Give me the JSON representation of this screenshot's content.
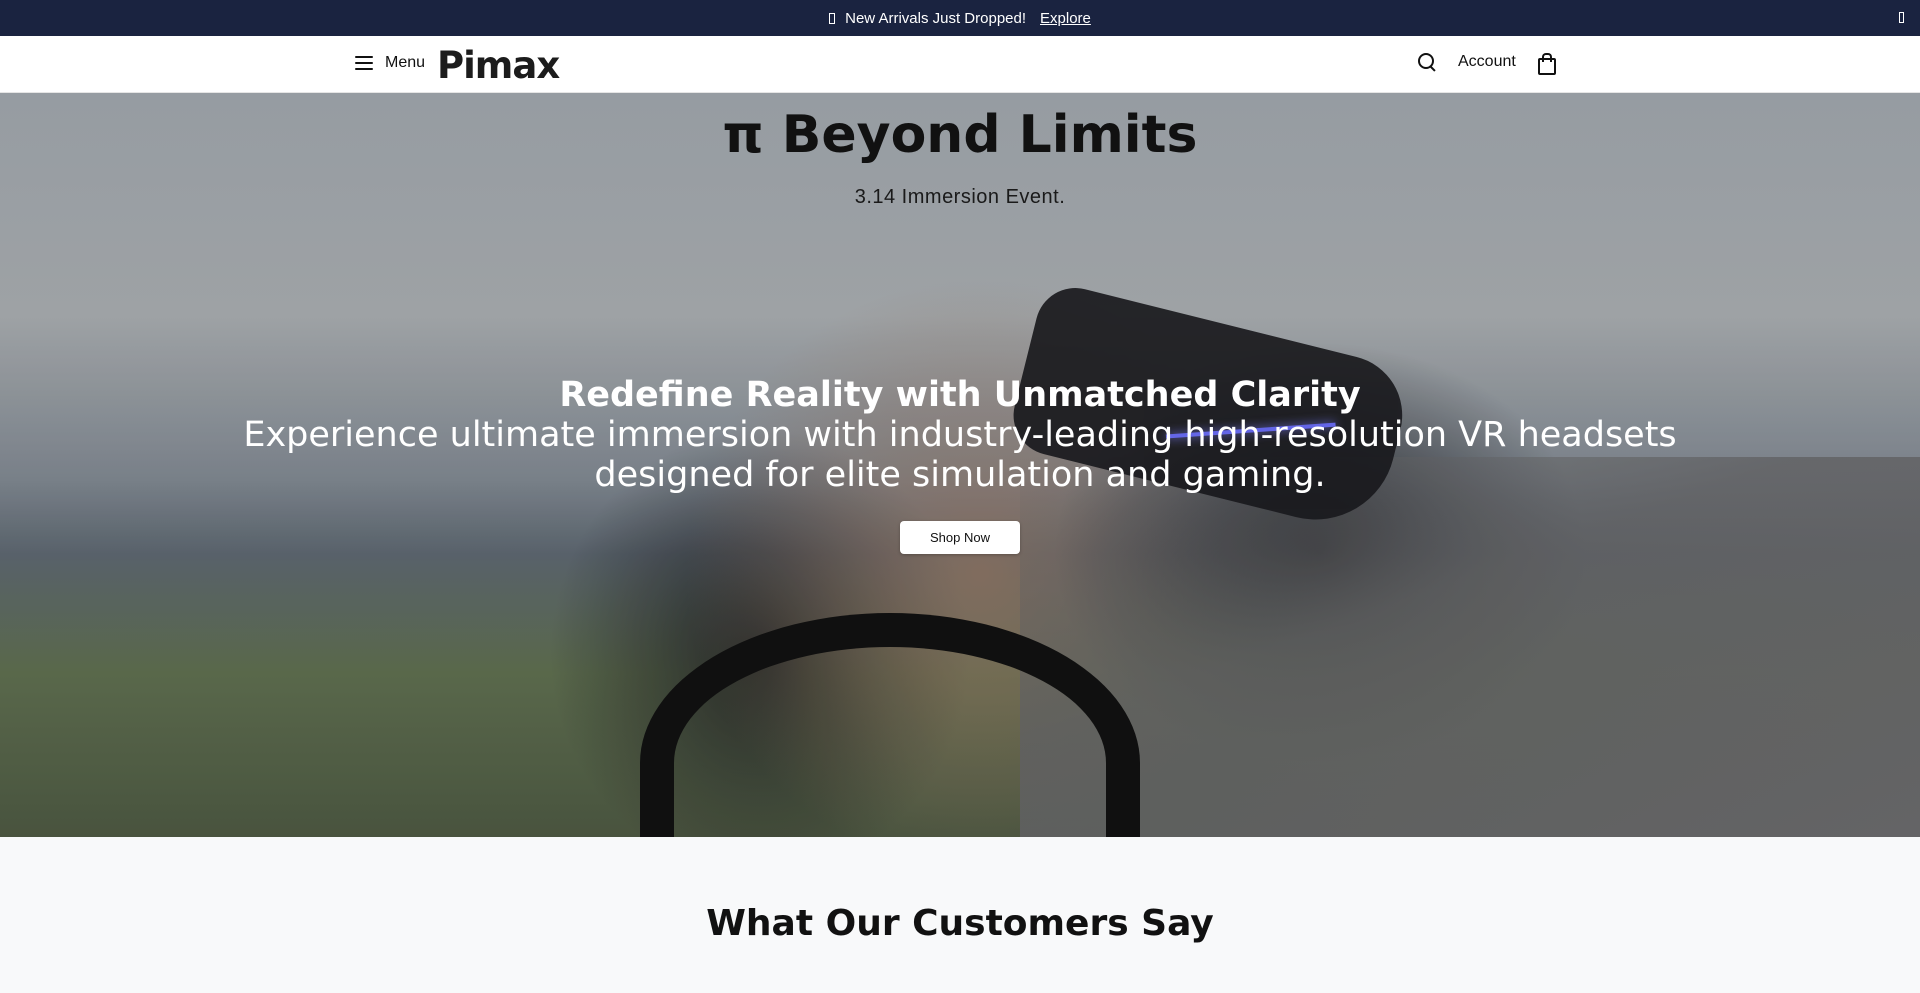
{
  "announcement": {
    "text": "New Arrivals Just Dropped!",
    "link": "Explore"
  },
  "header": {
    "menu_label": "Menu",
    "logo": "Pimax",
    "account_label": "Account"
  },
  "hero": {
    "title": "π Beyond Limits",
    "event": "3.14 Immersion Event.",
    "heading": "Redefine Reality with Unmatched Clarity",
    "subheading": "Experience ultimate immersion with industry-leading high-resolution VR headsets designed for elite simulation and gaming.",
    "cta_label": "Shop Now"
  },
  "testimonials": {
    "heading": "What Our Customers Say"
  },
  "colors": {
    "announcement_bg": "#1a2340",
    "header_bg": "#ffffff",
    "section_bg": "#f8f9fa"
  }
}
